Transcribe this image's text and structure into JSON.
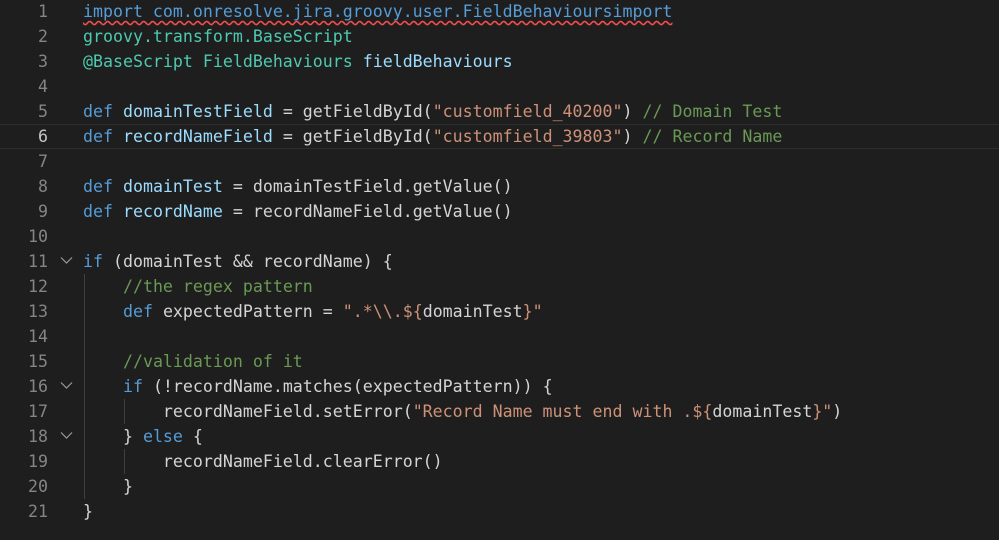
{
  "editor": {
    "language": "groovy",
    "current_line": 6,
    "lines": [
      {
        "n": "1",
        "tokens": [
          {
            "t": "import com.onresolve.jira.groovy.user.FieldBehavioursimport",
            "c": "squiggle"
          }
        ]
      },
      {
        "n": "2",
        "tokens": [
          {
            "t": "groovy.transform.BaseScript",
            "c": "type"
          }
        ]
      },
      {
        "n": "3",
        "tokens": [
          {
            "t": "@BaseScript FieldBehaviours ",
            "c": "attr"
          },
          {
            "t": "fieldBehaviours",
            "c": "var"
          }
        ]
      },
      {
        "n": "4",
        "tokens": []
      },
      {
        "n": "5",
        "tokens": [
          {
            "t": "def ",
            "c": "kw"
          },
          {
            "t": "domainTestField",
            "c": "var"
          },
          {
            "t": " = getFieldById(",
            "c": "plain"
          },
          {
            "t": "\"customfield_40200\"",
            "c": "str"
          },
          {
            "t": ") ",
            "c": "plain"
          },
          {
            "t": "// Domain Test",
            "c": "com"
          }
        ]
      },
      {
        "n": "6",
        "tokens": [
          {
            "t": "def ",
            "c": "kw"
          },
          {
            "t": "recordNameField",
            "c": "var"
          },
          {
            "t": " = getFieldById(",
            "c": "plain"
          },
          {
            "t": "\"customfield_39803\"",
            "c": "str"
          },
          {
            "t": ") ",
            "c": "plain"
          },
          {
            "t": "// Record Name",
            "c": "com"
          }
        ]
      },
      {
        "n": "7",
        "tokens": []
      },
      {
        "n": "8",
        "tokens": [
          {
            "t": "def ",
            "c": "kw"
          },
          {
            "t": "domainTest",
            "c": "var"
          },
          {
            "t": " = domainTestField.getValue()",
            "c": "plain"
          }
        ]
      },
      {
        "n": "9",
        "tokens": [
          {
            "t": "def ",
            "c": "kw"
          },
          {
            "t": "recordName",
            "c": "var"
          },
          {
            "t": " = recordNameField.getValue()",
            "c": "plain"
          }
        ]
      },
      {
        "n": "10",
        "tokens": []
      },
      {
        "n": "11",
        "fold": true,
        "tokens": [
          {
            "t": "if",
            "c": "kw"
          },
          {
            "t": " (domainTest && recordName) {",
            "c": "plain"
          }
        ]
      },
      {
        "n": "12",
        "tokens": [
          {
            "t": "    ",
            "c": "plain"
          },
          {
            "t": "//the regex pattern",
            "c": "com"
          }
        ]
      },
      {
        "n": "13",
        "tokens": [
          {
            "t": "    ",
            "c": "plain"
          },
          {
            "t": "def ",
            "c": "kw"
          },
          {
            "t": "expectedPattern = ",
            "c": "plain"
          },
          {
            "t": "\".*\\\\.${",
            "c": "str"
          },
          {
            "t": "domainTest",
            "c": "plain"
          },
          {
            "t": "}\"",
            "c": "str"
          }
        ]
      },
      {
        "n": "14",
        "tokens": []
      },
      {
        "n": "15",
        "tokens": [
          {
            "t": "    ",
            "c": "plain"
          },
          {
            "t": "//validation of it",
            "c": "com"
          }
        ]
      },
      {
        "n": "16",
        "fold": true,
        "tokens": [
          {
            "t": "    ",
            "c": "plain"
          },
          {
            "t": "if",
            "c": "kw"
          },
          {
            "t": " (!recordName.matches(expectedPattern)) {",
            "c": "plain"
          }
        ]
      },
      {
        "n": "17",
        "tokens": [
          {
            "t": "        recordNameField.setError(",
            "c": "plain"
          },
          {
            "t": "\"Record Name must end with .${",
            "c": "str"
          },
          {
            "t": "domainTest",
            "c": "plain"
          },
          {
            "t": "}\"",
            "c": "str"
          },
          {
            "t": ")",
            "c": "plain"
          }
        ]
      },
      {
        "n": "18",
        "fold": true,
        "tokens": [
          {
            "t": "    } ",
            "c": "plain"
          },
          {
            "t": "else",
            "c": "kw"
          },
          {
            "t": " {",
            "c": "plain"
          }
        ]
      },
      {
        "n": "19",
        "tokens": [
          {
            "t": "        recordNameField.clearError()",
            "c": "plain"
          }
        ]
      },
      {
        "n": "20",
        "tokens": [
          {
            "t": "    }",
            "c": "plain"
          }
        ]
      },
      {
        "n": "21",
        "tokens": [
          {
            "t": "}",
            "c": "plain"
          }
        ]
      }
    ]
  }
}
